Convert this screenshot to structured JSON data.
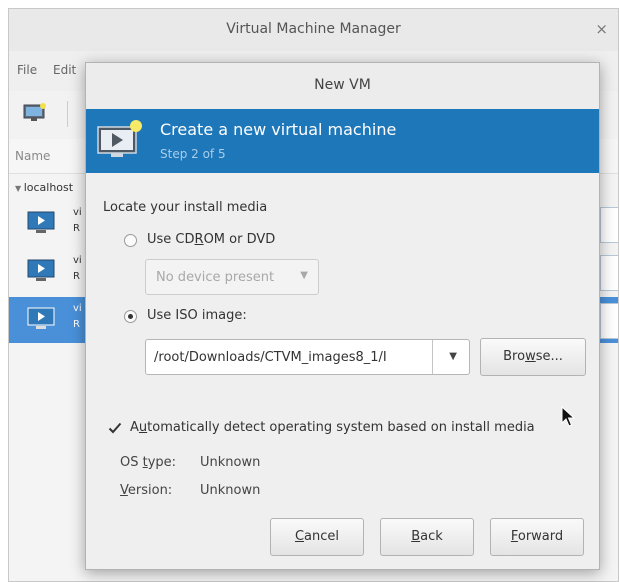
{
  "background_window": {
    "title": "Virtual Machine Manager",
    "close_glyph": "×",
    "menu": [
      "File",
      "Edit"
    ],
    "column_name": "Name",
    "group": "localhost",
    "vm_rows": [
      {
        "line1": "vi",
        "line2": "R",
        "selected": false
      },
      {
        "line1": "vi",
        "line2": "R",
        "selected": false
      },
      {
        "line1": "vi",
        "line2": "R",
        "selected": true
      }
    ]
  },
  "dialog": {
    "title": "New VM",
    "banner": {
      "title": "Create a new virtual machine",
      "step": "Step 2 of 5"
    },
    "section_label": "Locate your install media",
    "cdrom_option": {
      "pre": "Use CD",
      "mnemonic": "R",
      "post": "OM or DVD",
      "selected": false
    },
    "device_combo": {
      "value": "No device present",
      "arrow": "▼"
    },
    "iso_option": {
      "label": "Use ISO image:",
      "selected": true
    },
    "iso_path": {
      "value": "/root/Downloads/CTVM_images8_1/I",
      "arrow": "▼"
    },
    "browse_button": {
      "pre": "Bro",
      "mnemonic": "w",
      "post": "se..."
    },
    "auto_detect": {
      "pre": "A",
      "mnemonic": "u",
      "post": "tomatically detect operating system based on install media",
      "checked": true
    },
    "os_type": {
      "label_pre": "OS ",
      "label_mnemonic": "t",
      "label_post": "ype:",
      "value": "Unknown"
    },
    "version": {
      "label_mnemonic": "V",
      "label_post": "ersion:",
      "value": "Unknown"
    },
    "buttons": {
      "cancel": {
        "mnemonic": "C",
        "rest": "ancel"
      },
      "back": {
        "mnemonic": "B",
        "rest": "ack"
      },
      "forward": {
        "mnemonic": "F",
        "rest": "orward"
      }
    }
  },
  "colors": {
    "banner": "#1e77b9",
    "selection": "#4a90d9"
  },
  "icons": [
    "vm-monitor-icon",
    "close-icon",
    "dropdown-arrow-icon",
    "checkmark-icon",
    "mouse-cursor-icon"
  ]
}
